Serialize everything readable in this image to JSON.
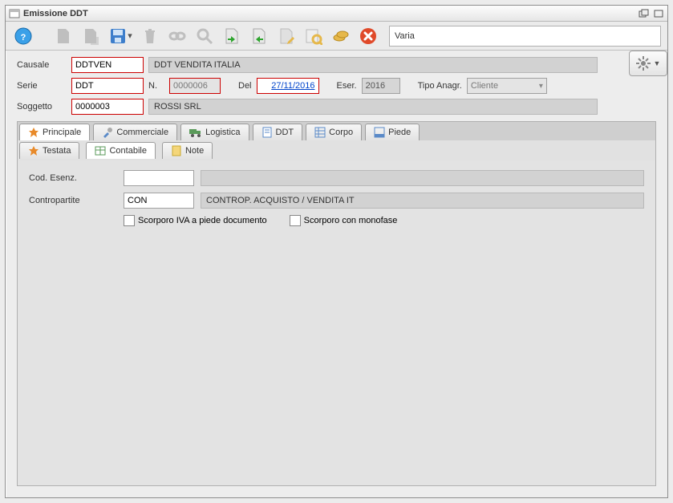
{
  "window": {
    "title": "Emissione DDT"
  },
  "toolbar": {
    "context": "Varia"
  },
  "form": {
    "causale": {
      "label": "Causale",
      "value": "DDTVEN",
      "desc": "DDT VENDITA ITALIA"
    },
    "serie": {
      "label": "Serie",
      "value": "DDT"
    },
    "numero": {
      "label": "N.",
      "value": "0000006"
    },
    "del": {
      "label": "Del",
      "value": "27/11/2016"
    },
    "eser": {
      "label": "Eser.",
      "value": "2016"
    },
    "tipoAnagr": {
      "label": "Tipo Anagr.",
      "value": "Cliente"
    },
    "soggetto": {
      "label": "Soggetto",
      "value": "0000003",
      "desc": "ROSSI SRL"
    }
  },
  "tabs": {
    "main": [
      "Principale",
      "Commerciale",
      "Logistica",
      "DDT",
      "Corpo",
      "Piede"
    ],
    "sub": [
      "Testata",
      "Contabile",
      "Note"
    ]
  },
  "panel": {
    "codEsenz": {
      "label": "Cod. Esenz.",
      "value": "",
      "desc": ""
    },
    "contropartite": {
      "label": "Contropartite",
      "value": "CON",
      "desc": "CONTROP. ACQUISTO / VENDITA IT"
    },
    "chk1": "Scorporo IVA a piede documento",
    "chk2": "Scorporo con monofase"
  }
}
